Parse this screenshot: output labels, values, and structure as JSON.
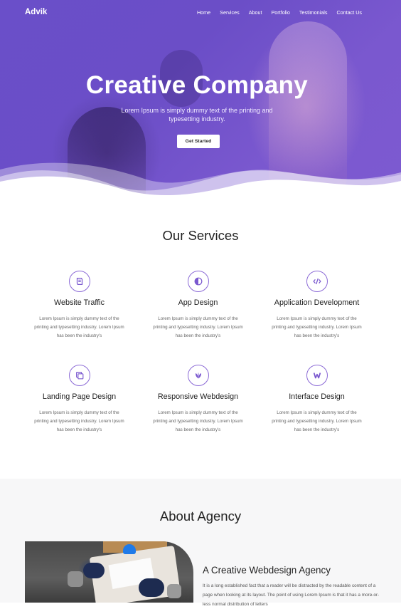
{
  "nav": {
    "brand": "Advik",
    "items": [
      "Home",
      "Services",
      "About",
      "Portfolio",
      "Testimonials",
      "Contact Us"
    ]
  },
  "hero": {
    "title": "Creative Company",
    "subtitle": "Lorem Ipsum is simply dummy text of the printing and typesetting industry.",
    "cta": "Get Started"
  },
  "services": {
    "title": "Our Services",
    "items": [
      {
        "name": "Website Traffic",
        "icon": "book-icon",
        "desc": "Lorem Ipsum is simply dummy text of the printing and typesetting industry. Lorem Ipsum has been the industry's"
      },
      {
        "name": "App Design",
        "icon": "half-circle-icon",
        "desc": "Lorem Ipsum is simply dummy text of the printing and typesetting industry. Lorem Ipsum has been the industry's"
      },
      {
        "name": "Application Development",
        "icon": "code-icon",
        "desc": "Lorem Ipsum is simply dummy text of the printing and typesetting industry. Lorem Ipsum has been the industry's"
      },
      {
        "name": "Landing Page Design",
        "icon": "copy-icon",
        "desc": "Lorem Ipsum is simply dummy text of the printing and typesetting industry. Lorem Ipsum has been the industry's"
      },
      {
        "name": "Responsive Webdesign",
        "icon": "leaf-icon",
        "desc": "Lorem Ipsum is simply dummy text of the printing and typesetting industry. Lorem Ipsum has been the industry's"
      },
      {
        "name": "Interface Design",
        "icon": "w-icon",
        "desc": "Lorem Ipsum is simply dummy text of the printing and typesetting industry. Lorem Ipsum has been the industry's"
      }
    ]
  },
  "about": {
    "title": "About Agency",
    "heading": "A Creative Webdesign Agency",
    "text": "It is a long established fact that a reader will be distracted by the readable content of a page when looking at its layout. The point of using Lorem Ipsum is that it has a more-or-less normal distribution of letters"
  },
  "colors": {
    "accent": "#6b4ec7",
    "icon_stroke": "#8b6ad6"
  }
}
